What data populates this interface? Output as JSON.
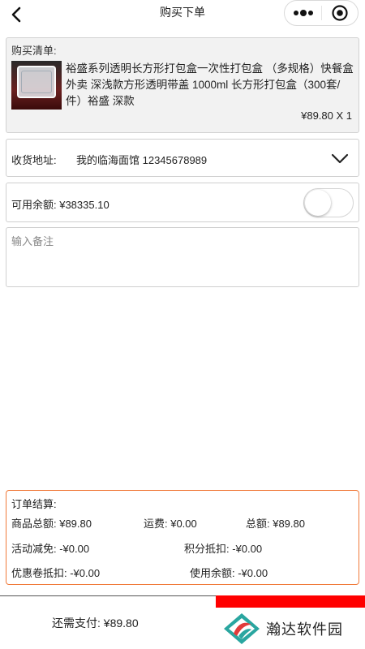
{
  "header": {
    "title": "购买下单"
  },
  "purchase_list": {
    "heading": "购买清单:",
    "product_name": "裕盛系列透明长方形打包盒一次性打包盒 （多规格）快餐盒 外卖 深浅款方形透明带盖 1000ml 长方形打包盒（300套/件）裕盛 深款",
    "price_qty": "¥89.80 X 1"
  },
  "address": {
    "label": "收货地址:",
    "value": "我的临海面馆 12345678989"
  },
  "balance": {
    "label": "可用余额: ¥38335.10",
    "enabled": false
  },
  "remark": {
    "placeholder": "输入备注",
    "value": ""
  },
  "summary": {
    "heading": "订单结算:",
    "goods_total": "商品总额: ¥89.80",
    "shipping": "运费: ¥0.00",
    "total": "总额: ¥89.80",
    "promo_discount": "活动减免: -¥0.00",
    "points_deduct": "积分抵扣: -¥0.00",
    "coupon_deduct": "优惠卷抵扣: -¥0.00",
    "balance_used": "使用余额: -¥0.00"
  },
  "bottom": {
    "pay_text": "还需支付: ¥89.80",
    "brand_name": "瀚达软件园"
  },
  "colors": {
    "accent": "#f07a3a",
    "brand_red": "#ff0000",
    "logo_teal": "#2aa6a0",
    "logo_red": "#e23b3b"
  }
}
